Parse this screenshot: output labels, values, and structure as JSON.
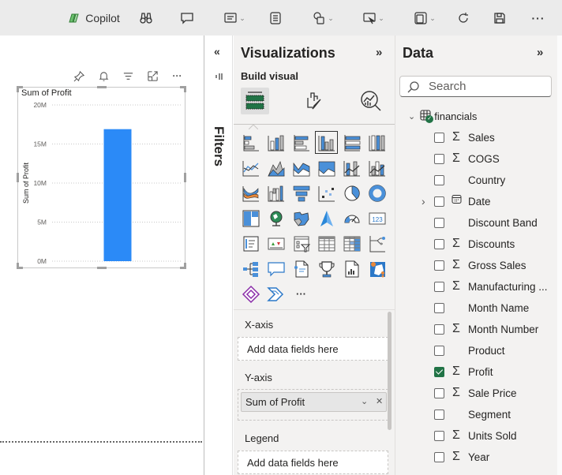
{
  "toolbar": {
    "copilot_label": "Copilot",
    "icons": [
      "copilot-icon",
      "binoculars-icon",
      "comment-icon",
      "smart-narrative-icon",
      "notes-icon",
      "shapes-icon",
      "button-icon",
      "visual-container-icon",
      "refresh-icon",
      "save-icon",
      "more-icon"
    ]
  },
  "visual": {
    "header_icons": [
      "pin-icon",
      "bell-icon",
      "filter-icon",
      "focus-mode-icon",
      "more-options-icon"
    ],
    "title": "Sum of Profit"
  },
  "chart_data": {
    "type": "bar",
    "title": "Sum of Profit",
    "categories": [
      ""
    ],
    "values": [
      16.9
    ],
    "unit": "M",
    "xlabel": "",
    "ylabel": "Sum of Profit",
    "ylim": [
      0,
      20
    ],
    "yticks": [
      0,
      5,
      10,
      15,
      20
    ],
    "ytick_labels": [
      "0M",
      "5M",
      "10M",
      "15M",
      "20M"
    ],
    "grid": true,
    "bar_color": "#2b8af7"
  },
  "filters": {
    "label": "Filters",
    "collapse_icon": "«"
  },
  "visualizations": {
    "title": "Visualizations",
    "expand_icon": "»",
    "section": "Build visual",
    "tabs": [
      "build-visual",
      "format-visual",
      "analytics"
    ],
    "more_label": "···",
    "wells": {
      "x_axis": {
        "label": "X-axis",
        "placeholder": "Add data fields here"
      },
      "y_axis": {
        "label": "Y-axis",
        "value": "Sum of Profit"
      },
      "legend": {
        "label": "Legend",
        "placeholder": "Add data fields here"
      }
    }
  },
  "data": {
    "title": "Data",
    "expand_icon": "»",
    "search_placeholder": "Search",
    "table": "financials",
    "fields": [
      {
        "name": "Sales",
        "type": "sum",
        "checked": false
      },
      {
        "name": "COGS",
        "type": "sum",
        "checked": false
      },
      {
        "name": "Country",
        "type": "text",
        "checked": false
      },
      {
        "name": "Date",
        "type": "date",
        "checked": false,
        "expandable": true
      },
      {
        "name": "Discount Band",
        "type": "text",
        "checked": false
      },
      {
        "name": "Discounts",
        "type": "sum",
        "checked": false
      },
      {
        "name": "Gross Sales",
        "type": "sum",
        "checked": false
      },
      {
        "name": "Manufacturing ...",
        "type": "sum",
        "checked": false
      },
      {
        "name": "Month Name",
        "type": "text",
        "checked": false
      },
      {
        "name": "Month Number",
        "type": "sum",
        "checked": false
      },
      {
        "name": "Product",
        "type": "text",
        "checked": false
      },
      {
        "name": "Profit",
        "type": "sum",
        "checked": true
      },
      {
        "name": "Sale Price",
        "type": "sum",
        "checked": false
      },
      {
        "name": "Segment",
        "type": "text",
        "checked": false
      },
      {
        "name": "Units Sold",
        "type": "sum",
        "checked": false
      },
      {
        "name": "Year",
        "type": "sum",
        "checked": false
      }
    ]
  }
}
